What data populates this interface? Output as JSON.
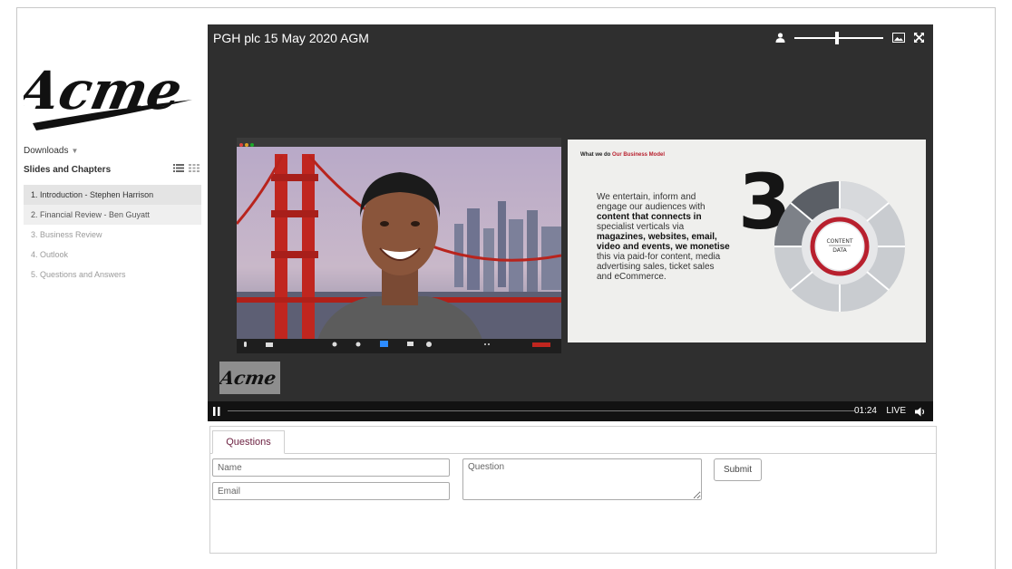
{
  "brand": {
    "logo_text": "Acme",
    "small_logo_text": "Acme"
  },
  "sidebar": {
    "downloads_label": "Downloads",
    "chapters_title": "Slides and Chapters",
    "chapters": [
      "1. Introduction - Stephen Harrison",
      "2. Financial Review - Ben Guyatt",
      "3. Business Review",
      "4. Outlook",
      "5. Questions and Answers"
    ]
  },
  "player": {
    "title": "PGH plc 15 May 2020 AGM",
    "volume_level": 0.48,
    "time": "01:24",
    "live_label": "LIVE"
  },
  "slide": {
    "heading_prefix": "What we do ",
    "heading_accent": "Our Business Model",
    "body_lines": [
      "We entertain, inform and",
      "engage our audiences with",
      "content that connects in",
      "specialist verticals via",
      "magazines, websites, email,",
      "video and events, we monetise",
      "this via paid-for content, media",
      "advertising sales, ticket sales",
      "and eCommerce."
    ],
    "center_top": "CONTENT",
    "center_bottom": "DATA",
    "big_number": "3"
  },
  "questions": {
    "tab_label": "Questions",
    "name_placeholder": "Name",
    "email_placeholder": "Email",
    "question_placeholder": "Question",
    "submit_label": "Submit"
  },
  "colors": {
    "accent": "#6b1f3f",
    "player_bg": "#2f2f2f",
    "slide_red": "#b8202e"
  }
}
